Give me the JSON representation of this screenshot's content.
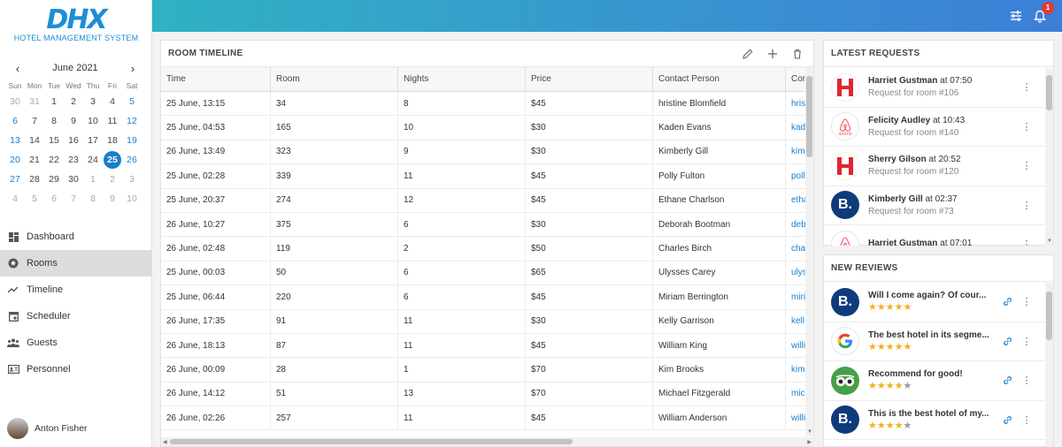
{
  "brand": {
    "mark": "DHX",
    "subtitle": "HOTEL MANAGEMENT SYSTEM"
  },
  "calendar": {
    "month_label": "June 2021",
    "weekdays": [
      "Sun",
      "Mon",
      "Tue",
      "Wed",
      "Thu",
      "Fri",
      "Sat"
    ],
    "weeks": [
      [
        "30",
        "31",
        "1",
        "2",
        "3",
        "4",
        "5"
      ],
      [
        "6",
        "7",
        "8",
        "9",
        "10",
        "11",
        "12"
      ],
      [
        "13",
        "14",
        "15",
        "16",
        "17",
        "18",
        "19"
      ],
      [
        "20",
        "21",
        "22",
        "23",
        "24",
        "25",
        "26"
      ],
      [
        "27",
        "28",
        "29",
        "30",
        "1",
        "2",
        "3"
      ],
      [
        "4",
        "5",
        "6",
        "7",
        "8",
        "9",
        "10"
      ]
    ],
    "selected": "25"
  },
  "nav": [
    {
      "label": "Dashboard",
      "icon": "dashboard-icon"
    },
    {
      "label": "Rooms",
      "icon": "star-icon",
      "active": true
    },
    {
      "label": "Timeline",
      "icon": "trend-icon"
    },
    {
      "label": "Scheduler",
      "icon": "calendar-icon"
    },
    {
      "label": "Guests",
      "icon": "people-icon"
    },
    {
      "label": "Personnel",
      "icon": "id-card-icon"
    }
  ],
  "user": {
    "name": "Anton Fisher"
  },
  "topbar": {
    "notification_count": "1"
  },
  "timeline": {
    "title": "ROOM TIMELINE",
    "columns": [
      "Time",
      "Room",
      "Nights",
      "Price",
      "Contact Person",
      "Con"
    ],
    "rows": [
      [
        "25 June, 13:15",
        "34",
        "8",
        "$45",
        "hristine Blomfield",
        "hris"
      ],
      [
        "25 June, 04:53",
        "165",
        "10",
        "$30",
        "Kaden Evans",
        "kad"
      ],
      [
        "26 June, 13:49",
        "323",
        "9",
        "$30",
        "Kimberly Gill",
        "kim"
      ],
      [
        "25 June, 02:28",
        "339",
        "11",
        "$45",
        "Polly Fulton",
        "poll"
      ],
      [
        "25 June, 20:37",
        "274",
        "12",
        "$45",
        "Ethane Charlson",
        "etha"
      ],
      [
        "26 June, 10:27",
        "375",
        "6",
        "$30",
        "Deborah Bootman",
        "deb"
      ],
      [
        "26 June, 02:48",
        "119",
        "2",
        "$50",
        "Charles Birch",
        "cha"
      ],
      [
        "25 June, 00:03",
        "50",
        "6",
        "$65",
        "Ulysses Carey",
        "ulys"
      ],
      [
        "25 June, 06:44",
        "220",
        "6",
        "$45",
        "Miriam Berrington",
        "miri"
      ],
      [
        "26 June, 17:35",
        "91",
        "11",
        "$30",
        "Kelly Garrison",
        "kell"
      ],
      [
        "26 June, 18:13",
        "87",
        "11",
        "$45",
        "William King",
        "willi"
      ],
      [
        "26 June, 00:09",
        "28",
        "1",
        "$70",
        "Kim Brooks",
        "kim"
      ],
      [
        "26 June, 14:12",
        "51",
        "13",
        "$70",
        "Michael Fitzgerald",
        "mic"
      ],
      [
        "26 June, 02:26",
        "257",
        "11",
        "$45",
        "William Anderson",
        "willi"
      ]
    ]
  },
  "requests": {
    "title": "LATEST REQUESTS",
    "items": [
      {
        "name": "Harriet Gustman",
        "time_prefix": "at",
        "time": "07:50",
        "detail": "Request for room #106",
        "source": "hilton"
      },
      {
        "name": "Felicity Audley",
        "time_prefix": "at",
        "time": "10:43",
        "detail": "Request for room #140",
        "source": "airbnb"
      },
      {
        "name": "Sherry Gilson",
        "time_prefix": "at",
        "time": "20:52",
        "detail": "Request for room #120",
        "source": "hilton"
      },
      {
        "name": "Kimberly Gill",
        "time_prefix": "at",
        "time": "02:37",
        "detail": "Request for room #73",
        "source": "booking"
      },
      {
        "name": "Harriet Gustman",
        "time_prefix": "at",
        "time": "07:01",
        "detail": "",
        "source": "airbnb"
      }
    ]
  },
  "reviews": {
    "title": "NEW REVIEWS",
    "items": [
      {
        "text": "Will I come again? Of cour...",
        "rating": 5,
        "source": "booking"
      },
      {
        "text": "The best hotel in its segme...",
        "rating": 5,
        "source": "google"
      },
      {
        "text": "Recommend for good!",
        "rating": 4,
        "source": "tripadvisor"
      },
      {
        "text": "This is the best hotel of my...",
        "rating": 4,
        "source": "booking"
      }
    ]
  },
  "logo_text": {
    "airbnb": "airbnb",
    "booking": "B."
  },
  "colors": {
    "accent": "#1b7fcc",
    "star": "#f2b01e",
    "topbar_start": "#30b2c4",
    "topbar_end": "#3d7fd8"
  }
}
